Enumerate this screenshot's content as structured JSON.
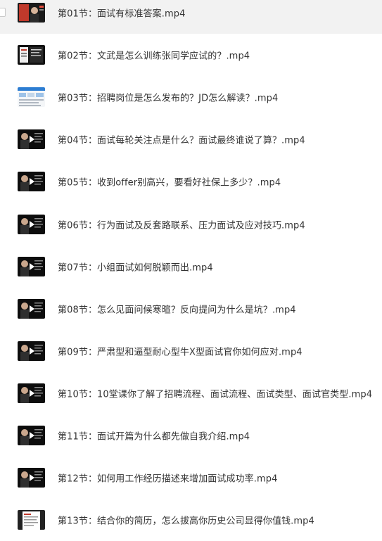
{
  "files": [
    {
      "name": "第01节：面试有标准答案.mp4",
      "thumb": "presenter-red-icon",
      "selected": true
    },
    {
      "name": "第02节：文武是怎么训练张同学应试的？.mp4",
      "thumb": "slide-collage-icon"
    },
    {
      "name": "第03节：招聘岗位是怎么发布的？JD怎么解读？.mp4",
      "thumb": "webpage-screenshot-icon"
    },
    {
      "name": "第04节：面试每轮关注点是什么？面试最终谁说了算？.mp4",
      "thumb": "video-play-icon"
    },
    {
      "name": "第05节：收到offer别高兴，要看好社保上多少？.mp4",
      "thumb": "video-play-icon"
    },
    {
      "name": "第06节：行为面试及反套路联系、压力面试及应对技巧.mp4",
      "thumb": "video-play-icon"
    },
    {
      "name": "第07节：小组面试如何脱颖而出.mp4",
      "thumb": "video-play-icon"
    },
    {
      "name": "第08节：怎么见面问候寒暄？反向提问为什么是坑？.mp4",
      "thumb": "video-play-icon"
    },
    {
      "name": "第09节：严肃型和逼型耐心型牛X型面试官你如何应对.mp4",
      "thumb": "video-play-icon"
    },
    {
      "name": "第10节：10堂课你了解了招聘流程、面试流程、面试类型、面试官类型.mp4",
      "thumb": "video-play-icon"
    },
    {
      "name": "第11节：面试开篇为什么都先做自我介绍.mp4",
      "thumb": "video-play-icon"
    },
    {
      "name": "第12节：如何用工作经历描述来增加面试成功率.mp4",
      "thumb": "video-play-icon"
    },
    {
      "name": "第13节：结合你的简历，怎么拔高你历史公司显得你值钱.mp4",
      "thumb": "document-icon"
    }
  ]
}
